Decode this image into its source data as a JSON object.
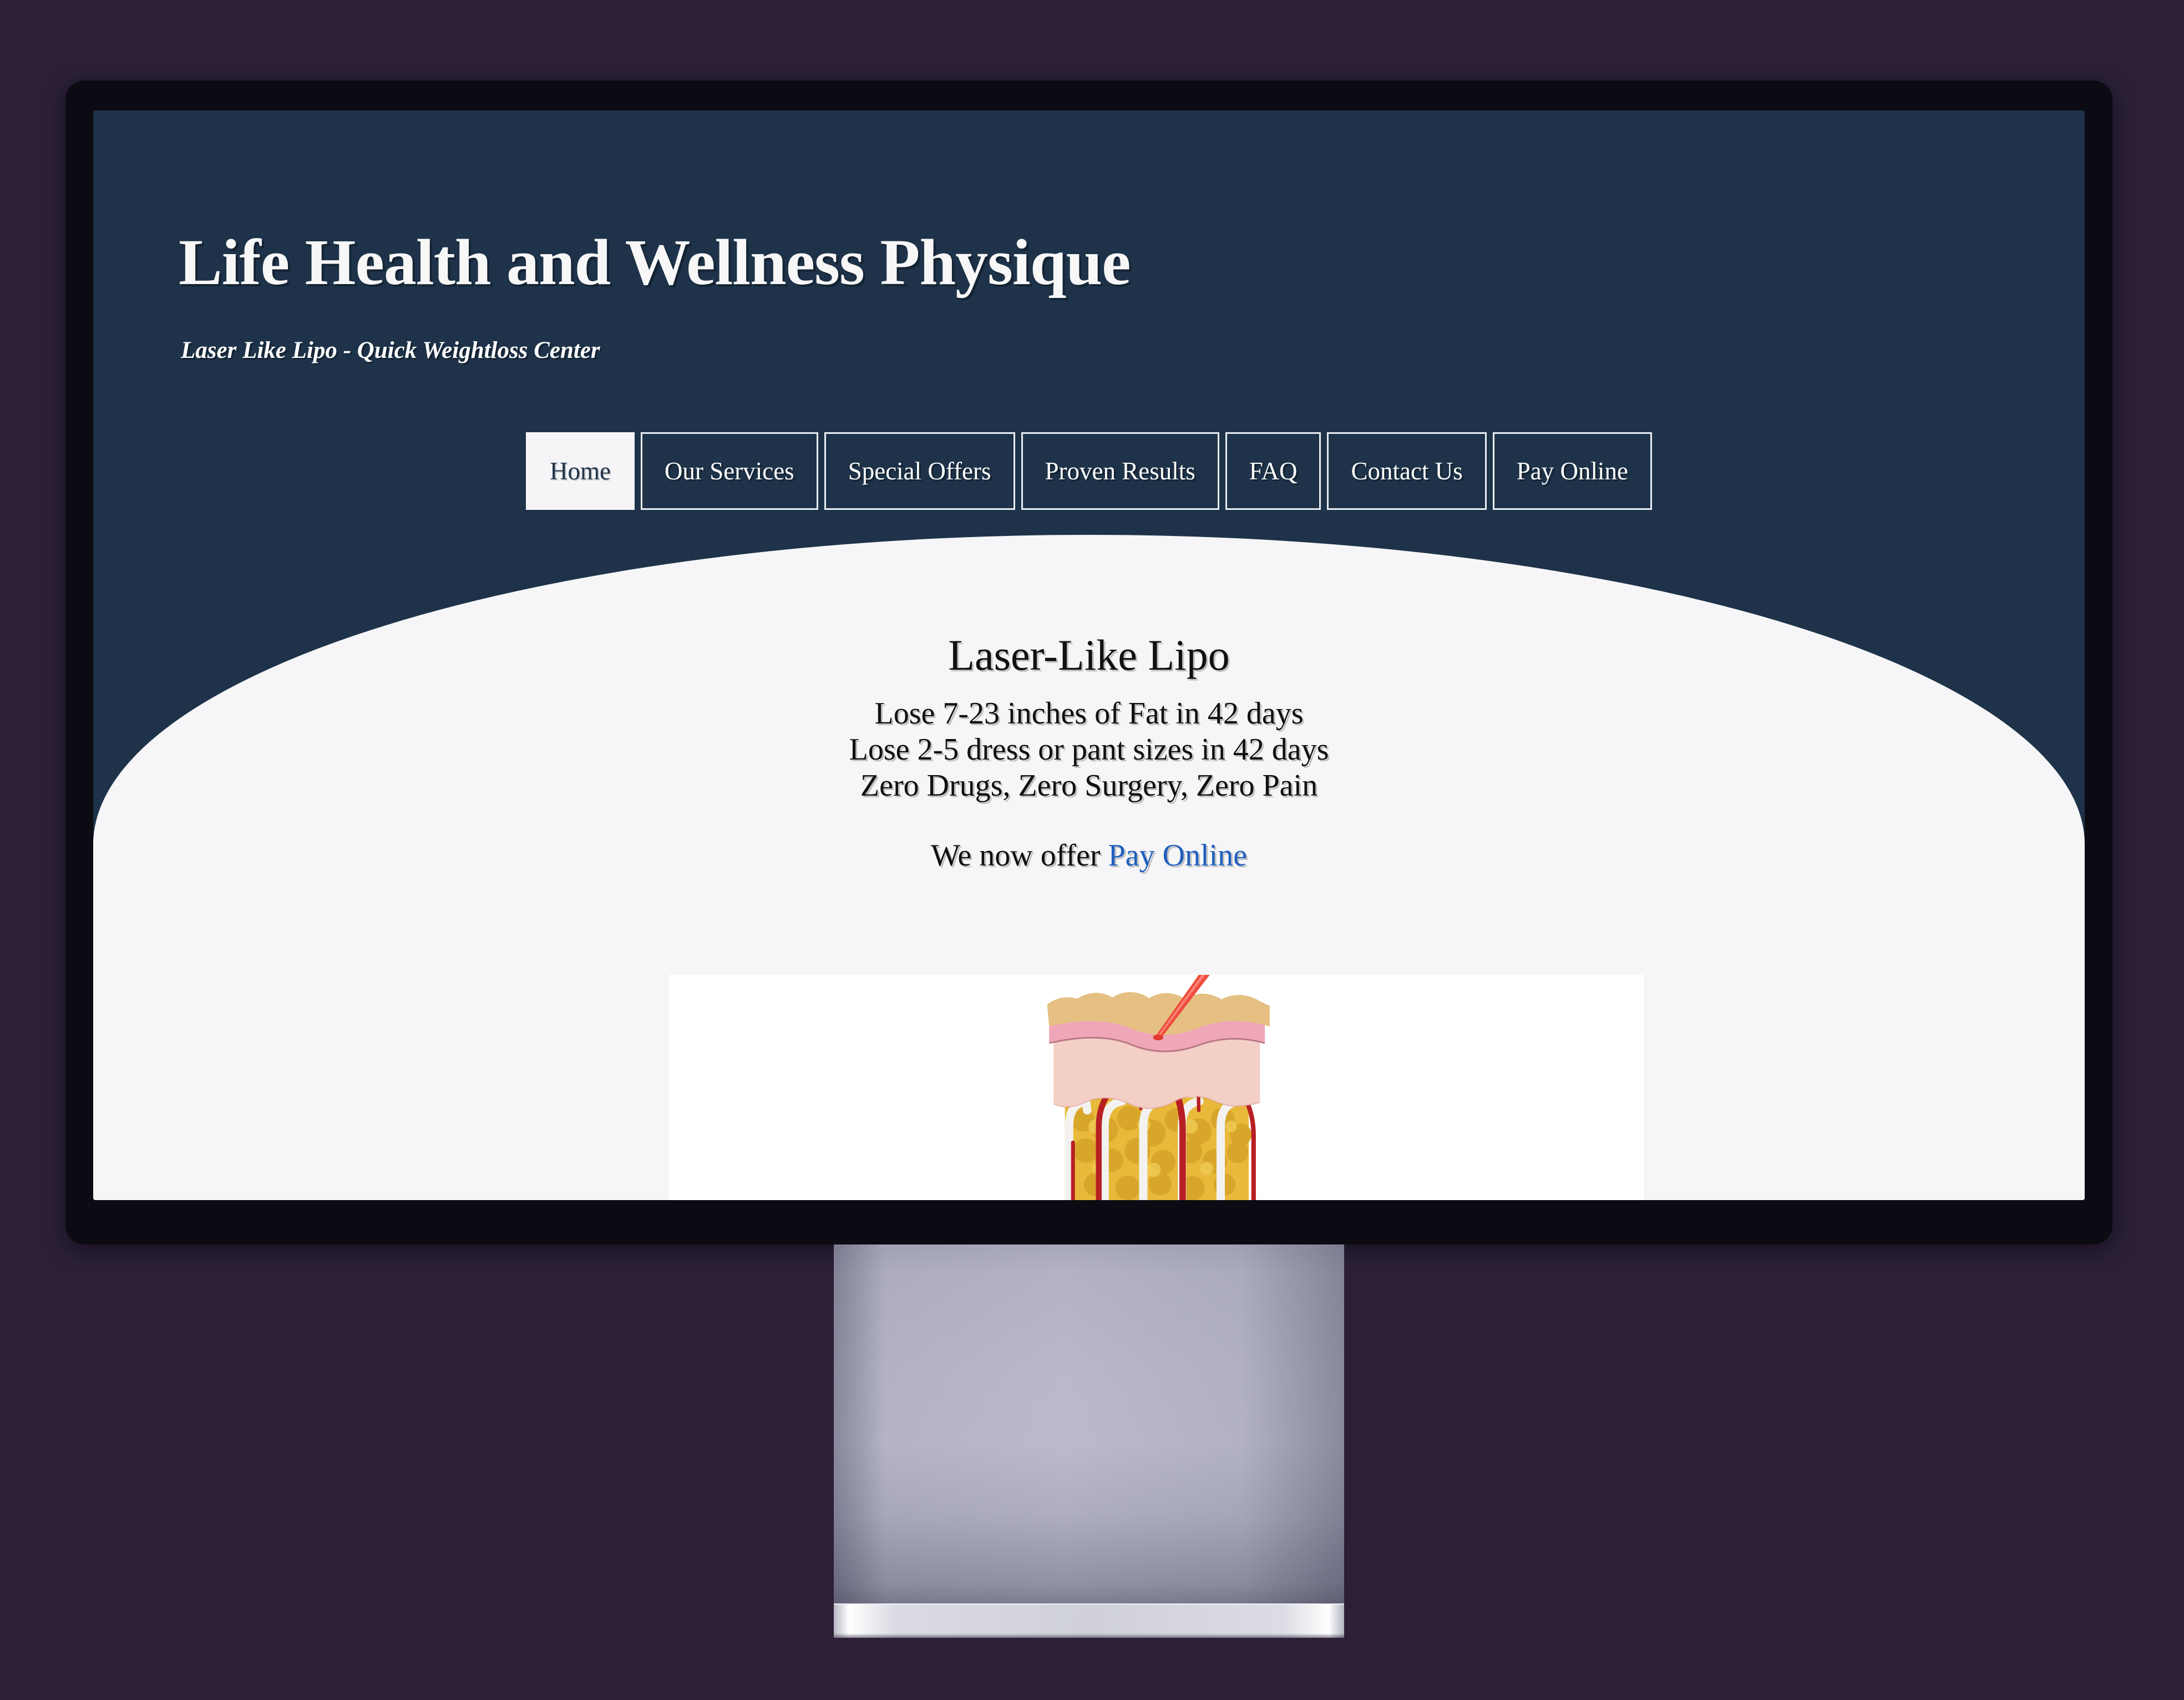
{
  "theme": {
    "page_background": "#2b2038",
    "bezel": "#0c0b13",
    "header_blue": "#1e3349",
    "content_background": "#f6f6f8",
    "link_blue": "#1f5fbe",
    "nav_border": "#e9edf2",
    "active_tab_background": "#f5f5f7"
  },
  "header": {
    "title": "Life Health and Wellness Physique",
    "tagline": "Laser Like Lipo - Quick Weightloss Center"
  },
  "nav": {
    "items": [
      {
        "label": "Home",
        "active": true
      },
      {
        "label": "Our Services",
        "active": false
      },
      {
        "label": "Special Offers",
        "active": false
      },
      {
        "label": "Proven Results",
        "active": false
      },
      {
        "label": "FAQ",
        "active": false
      },
      {
        "label": "Contact Us",
        "active": false
      },
      {
        "label": "Pay Online",
        "active": false
      }
    ]
  },
  "main": {
    "heading": "Laser-Like Lipo",
    "bullet_1": "Lose 7-23 inches of Fat in 42 days",
    "bullet_2": "Lose 2-5 dress or pant sizes in 42 days",
    "bullet_3": "Zero Drugs,   Zero Surgery,   Zero Pain",
    "offer_prefix": "We now offer ",
    "offer_link": "Pay Online",
    "illustration_alt": "skin-cross-section-laser-illustration"
  }
}
